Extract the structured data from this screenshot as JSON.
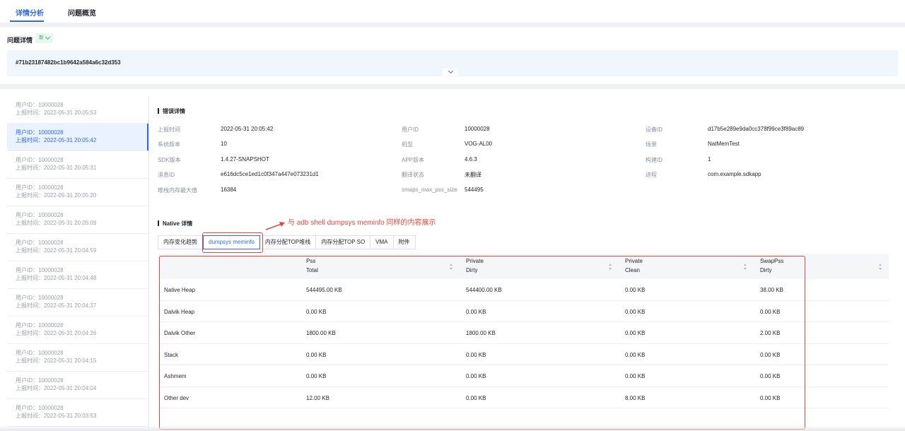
{
  "top_tabs": [
    {
      "label": "详情分析",
      "active": true
    },
    {
      "label": "问题概览",
      "active": false
    }
  ],
  "issue": {
    "label": "问题详情",
    "badge": "新",
    "hash": "#71b23187482bc1b9642a584a6c32d353"
  },
  "sidebar": {
    "items": [
      {
        "user": "用户ID：10000028",
        "time": "上报时间：2022-05-31 20:05:53",
        "active": false
      },
      {
        "user": "用户ID：10000028",
        "time": "上报时间：2022-05-31 20:05:42",
        "active": true
      },
      {
        "user": "用户ID：10000028",
        "time": "上报时间：2022-05-31 20:05:31",
        "active": false
      },
      {
        "user": "用户ID：10000028",
        "time": "上报时间：2022-05-31 20:05:20",
        "active": false
      },
      {
        "user": "用户ID：10000028",
        "time": "上报时间：2022-05-31 20:05:09",
        "active": false
      },
      {
        "user": "用户ID：10000028",
        "time": "上报时间：2022-05-31 20:04:59",
        "active": false
      },
      {
        "user": "用户ID：10000028",
        "time": "上报时间：2022-05-31 20:04:48",
        "active": false
      },
      {
        "user": "用户ID：10000028",
        "time": "上报时间：2022-05-31 20:04:37",
        "active": false
      },
      {
        "user": "用户ID：10000028",
        "time": "上报时间：2022-05-31 20:04:26",
        "active": false
      },
      {
        "user": "用户ID：10000028",
        "time": "上报时间：2022-05-31 20:04:15",
        "active": false
      },
      {
        "user": "用户ID：10000028",
        "time": "上报时间：2022-05-31 20:04:04",
        "active": false
      },
      {
        "user": "用户ID：10000028",
        "time": "上报时间：2022-05-31 20:03:53",
        "active": false
      }
    ]
  },
  "error_detail": {
    "title": "错误详情",
    "col1": [
      {
        "label": "上报时间",
        "value": "2022-05-31 20:05:42"
      },
      {
        "label": "系统版本",
        "value": "10"
      },
      {
        "label": "SDK版本",
        "value": "1.4.27-SNAPSHOT"
      },
      {
        "label": "消息ID",
        "value": "e616dc5ce1ed1c0f347a447e073231d1"
      },
      {
        "label": "堆栈内存最大值",
        "value": "16384"
      }
    ],
    "col2": [
      {
        "label": "用户ID",
        "value": "10000028"
      },
      {
        "label": "机型",
        "value": "VOG-AL00"
      },
      {
        "label": "APP版本",
        "value": "4.6.3"
      },
      {
        "label": "翻译状态",
        "value": "未翻译"
      },
      {
        "label": "smaps_max_pss_size",
        "value": "544495"
      }
    ],
    "col3": [
      {
        "label": "设备ID",
        "value": "d17b5e289e9da0cc378f99ce3f89ac89"
      },
      {
        "label": "场景",
        "value": "NatMemTest"
      },
      {
        "label": "构建ID",
        "value": "1"
      },
      {
        "label": "进程",
        "value": "com.example.sdkapp"
      }
    ]
  },
  "native": {
    "title": "Native 详情",
    "annotation": "与 adb shell dumpsys meminfo 同样的内容展示",
    "annotation_color": "#e5483a",
    "tabs": [
      {
        "label": "内存变化趋势",
        "active": false
      },
      {
        "label": "dumpsys meminfo",
        "active": true
      },
      {
        "label": "内存分配TOP堆栈",
        "active": false
      },
      {
        "label": "内存分配TOP SO",
        "active": false
      },
      {
        "label": "VMA",
        "active": false
      },
      {
        "label": "附件",
        "active": false
      }
    ]
  },
  "meminfo_table": {
    "headers": [
      {
        "line1": "",
        "line2": ""
      },
      {
        "line1": "Pss",
        "line2": "Total"
      },
      {
        "line1": "Private",
        "line2": "Dirty"
      },
      {
        "line1": "Private",
        "line2": "Clean"
      },
      {
        "line1": "SwapPss",
        "line2": "Dirty"
      }
    ],
    "rows": [
      [
        "Native Heap",
        "544495.00 KB",
        "544400.00 KB",
        "0.00 KB",
        "38.00 KB"
      ],
      [
        "Dalvik Heap",
        "0.00 KB",
        "0.00 KB",
        "0.00 KB",
        "0.00 KB"
      ],
      [
        "Dalvik Other",
        "1800.00 KB",
        "1800.00 KB",
        "0.00 KB",
        "2.00 KB"
      ],
      [
        "Stack",
        "0.00 KB",
        "0.00 KB",
        "0.00 KB",
        "0.00 KB"
      ],
      [
        "Ashmem",
        "0.00 KB",
        "0.00 KB",
        "0.00 KB",
        "0.00 KB"
      ],
      [
        "Other dev",
        "12.00 KB",
        "0.00 KB",
        "8.00 KB",
        "0.00 KB"
      ]
    ]
  },
  "colors": {
    "accent": "#2e69e6",
    "annotation": "#e5483a",
    "badge_green": "#3cb371"
  }
}
